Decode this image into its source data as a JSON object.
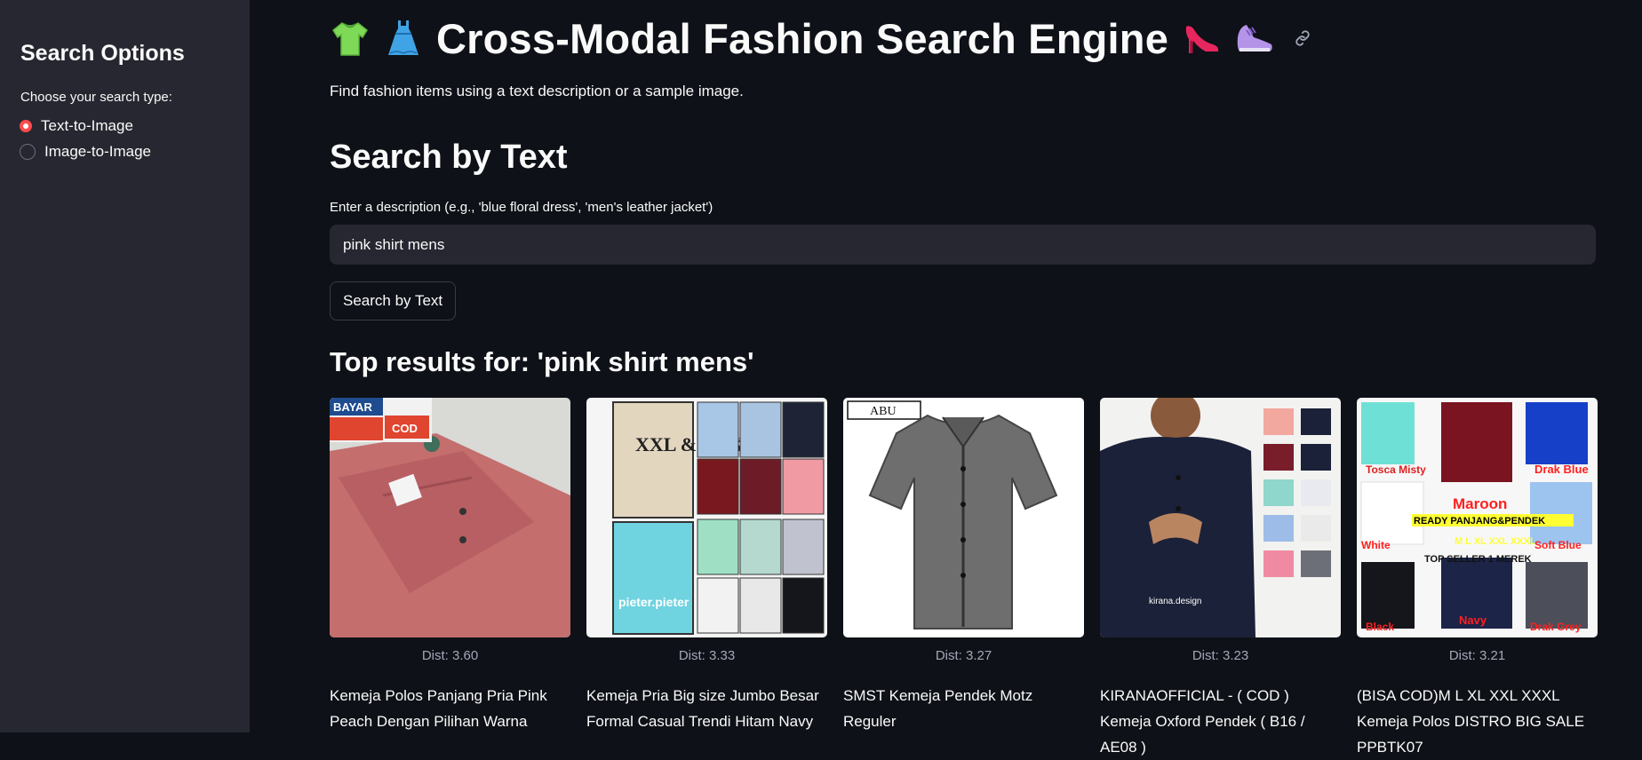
{
  "sidebar": {
    "title": "Search Options",
    "choose_label": "Choose your search type:",
    "options": [
      {
        "label": "Text-to-Image",
        "selected": true
      },
      {
        "label": "Image-to-Image",
        "selected": false
      }
    ]
  },
  "header": {
    "title": "Cross-Modal Fashion Search Engine",
    "subtitle": "Find fashion items using a text description or a sample image.",
    "icons": [
      "tshirt-emoji",
      "dress-emoji",
      "high-heel-emoji",
      "sneaker-emoji",
      "link-icon"
    ]
  },
  "search": {
    "heading": "Search by Text",
    "input_label": "Enter a description (e.g., 'blue floral dress', 'men's leather jacket')",
    "input_value": "pink shirt mens",
    "button_label": "Search by Text"
  },
  "results": {
    "heading": "Top results for: 'pink shirt mens'",
    "items": [
      {
        "dist": "Dist: 3.60",
        "title": "Kemeja Polos Panjang Pria Pink Peach Dengan Pilihan Warna"
      },
      {
        "dist": "Dist: 3.33",
        "title": "Kemeja Pria Big size Jumbo Besar Formal Casual Trendi Hitam Navy"
      },
      {
        "dist": "Dist: 3.27",
        "title": "SMST Kemeja Pendek Motz Reguler"
      },
      {
        "dist": "Dist: 3.23",
        "title": "KIRANAOFFICIAL - ( COD ) Kemeja Oxford Pendek ( B16 / AE08 )"
      },
      {
        "dist": "Dist: 3.21",
        "title": "(BISA COD)M L XL XXL XXXL Kemeja Polos DISTRO BIG SALE PPBTK07"
      }
    ],
    "image_text": {
      "card1_badge": "BAYAR",
      "card1_cod": "COD",
      "card2_big": "XXL & XXXL",
      "card2_brand": "pieter.pieter",
      "card3_tag": "ABU",
      "card4_brand": "kirana.design",
      "card5_words": [
        "Tosca Misty",
        "Maroon",
        "Drak Blue",
        "READY PANJANG&PENDEK",
        "White",
        "M L XL XXL XXXL",
        "Soft Blue",
        "TOP SELLER 1 MEREK",
        "Black",
        "Navy",
        "Drak Grey"
      ]
    }
  },
  "colors": {
    "background": "#0e1117",
    "sidebar": "#262730",
    "accent": "#ff4b4b",
    "muted": "#a3a8b8"
  }
}
